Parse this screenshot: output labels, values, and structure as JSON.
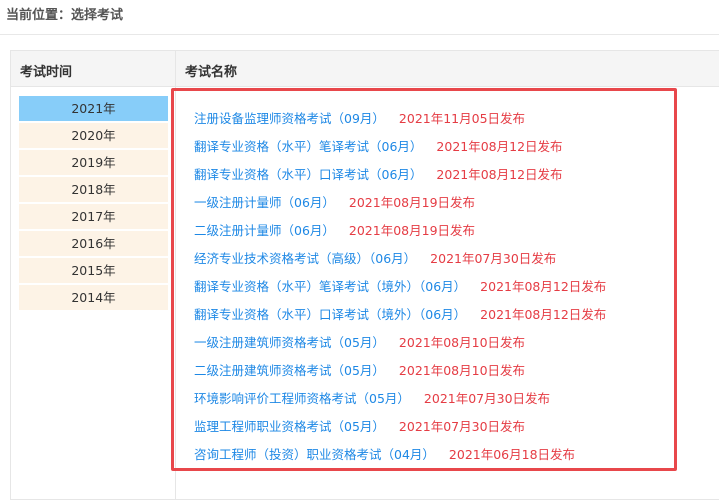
{
  "location": "当前位置：选择考试",
  "table": {
    "col_time": "考试时间",
    "col_name": "考试名称"
  },
  "years": [
    {
      "label": "2021年",
      "active": true
    },
    {
      "label": "2020年"
    },
    {
      "label": "2019年"
    },
    {
      "label": "2018年"
    },
    {
      "label": "2017年"
    },
    {
      "label": "2016年"
    },
    {
      "label": "2015年"
    },
    {
      "label": "2014年"
    }
  ],
  "exams": [
    {
      "name": "注册设备监理师资格考试（09月）",
      "date": "2021年11月05日发布"
    },
    {
      "name": "翻译专业资格（水平）笔译考试（06月）",
      "date": "2021年08月12日发布"
    },
    {
      "name": "翻译专业资格（水平）口译考试（06月）",
      "date": "2021年08月12日发布"
    },
    {
      "name": "一级注册计量师（06月）",
      "date": "2021年08月19日发布"
    },
    {
      "name": "二级注册计量师（06月）",
      "date": "2021年08月19日发布"
    },
    {
      "name": "经济专业技术资格考试（高级）（06月）",
      "date": "2021年07月30日发布"
    },
    {
      "name": "翻译专业资格（水平）笔译考试（境外）（06月）",
      "date": "2021年08月12日发布"
    },
    {
      "name": "翻译专业资格（水平）口译考试（境外）（06月）",
      "date": "2021年08月12日发布"
    },
    {
      "name": "一级注册建筑师资格考试（05月）",
      "date": "2021年08月10日发布"
    },
    {
      "name": "二级注册建筑师资格考试（05月）",
      "date": "2021年08月10日发布"
    },
    {
      "name": "环境影响评价工程师资格考试（05月）",
      "date": "2021年07月30日发布"
    },
    {
      "name": "监理工程师职业资格考试（05月）",
      "date": "2021年07月30日发布"
    },
    {
      "name": "咨询工程师（投资）职业资格考试（04月）",
      "date": "2021年06月18日发布"
    }
  ],
  "colors": {
    "link": "#1e88e5",
    "date": "#e53c44",
    "highlight": "#e8474b",
    "active_year": "#87cdf9"
  }
}
